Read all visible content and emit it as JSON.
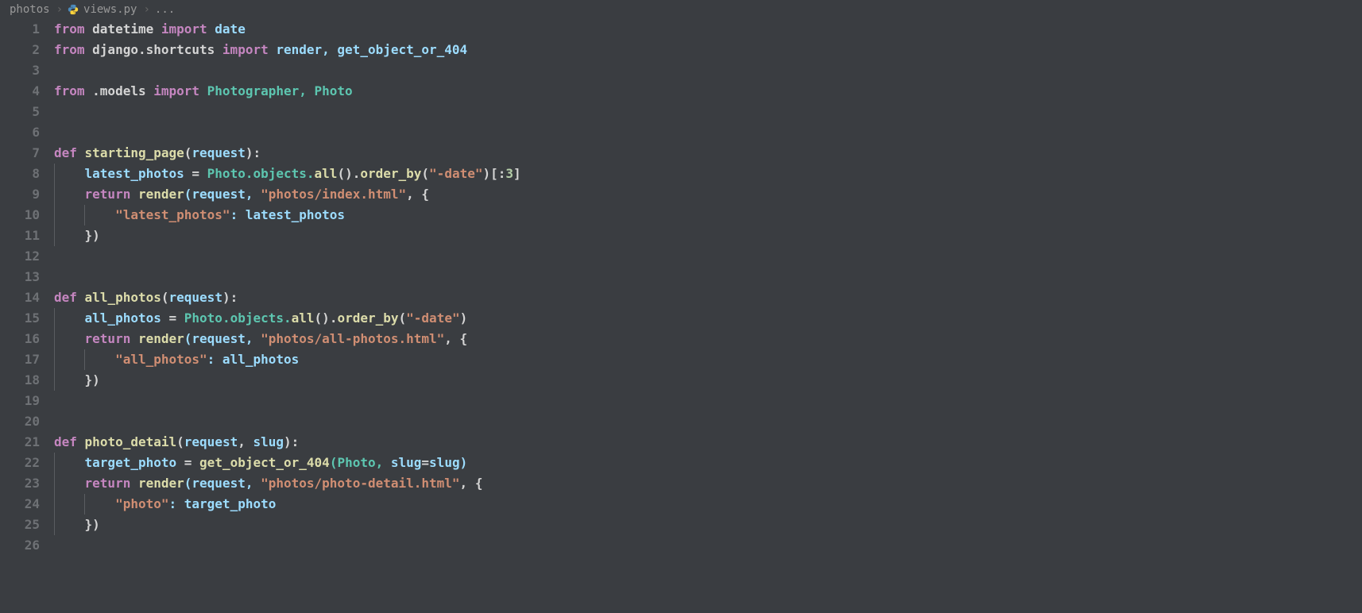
{
  "breadcrumb": {
    "folder": "photos",
    "file": "views.py",
    "symbol": "..."
  },
  "lines": [
    "1",
    "2",
    "3",
    "4",
    "5",
    "6",
    "7",
    "8",
    "9",
    "10",
    "11",
    "12",
    "13",
    "14",
    "15",
    "16",
    "17",
    "18",
    "19",
    "20",
    "21",
    "22",
    "23",
    "24",
    "25",
    "26"
  ],
  "code": {
    "l1": {
      "t1": "from",
      "t2": " datetime ",
      "t3": "import",
      "t4": " date"
    },
    "l2": {
      "t1": "from",
      "t2": " django.shortcuts ",
      "t3": "import",
      "t4": " render, get_object_or_404"
    },
    "l4": {
      "t1": "from",
      "t2": " .models ",
      "t3": "import",
      "t4": " Photographer, Photo"
    },
    "l7": {
      "t1": "def",
      "t2": " ",
      "t3": "starting_page",
      "t4": "(",
      "t5": "request",
      "t6": "):"
    },
    "l8": {
      "t1": "    latest_photos ",
      "t2": "=",
      "t3": " Photo.objects.",
      "t4": "all",
      "t5": "().",
      "t6": "order_by",
      "t7": "(",
      "t8": "\"-date\"",
      "t9": ")[:",
      "t10": "3",
      "t11": "]"
    },
    "l9": {
      "t1": "    ",
      "t2": "return",
      "t3": " ",
      "t4": "render",
      "t5": "(request, ",
      "t6": "\"photos/index.html\"",
      "t7": ", {"
    },
    "l10": {
      "t1": "        ",
      "t2": "\"latest_photos\"",
      "t3": ": latest_photos"
    },
    "l11": {
      "t1": "    })"
    },
    "l14": {
      "t1": "def",
      "t2": " ",
      "t3": "all_photos",
      "t4": "(",
      "t5": "request",
      "t6": "):"
    },
    "l15": {
      "t1": "    all_photos ",
      "t2": "=",
      "t3": " Photo.objects.",
      "t4": "all",
      "t5": "().",
      "t6": "order_by",
      "t7": "(",
      "t8": "\"-date\"",
      "t9": ")"
    },
    "l16": {
      "t1": "    ",
      "t2": "return",
      "t3": " ",
      "t4": "render",
      "t5": "(request, ",
      "t6": "\"photos/all-photos.html\"",
      "t7": ", {"
    },
    "l17": {
      "t1": "        ",
      "t2": "\"all_photos\"",
      "t3": ": all_photos"
    },
    "l18": {
      "t1": "    })"
    },
    "l21": {
      "t1": "def",
      "t2": " ",
      "t3": "photo_detail",
      "t4": "(",
      "t5": "request",
      "t6": ", ",
      "t7": "slug",
      "t8": "):"
    },
    "l22": {
      "t1": "    target_photo ",
      "t2": "=",
      "t3": " ",
      "t4": "get_object_or_404",
      "t5": "(Photo, ",
      "t6": "slug",
      "t7": "=",
      "t8": "slug)"
    },
    "l23": {
      "t1": "    ",
      "t2": "return",
      "t3": " ",
      "t4": "render",
      "t5": "(request, ",
      "t6": "\"photos/photo-detail.html\"",
      "t7": ", {"
    },
    "l24": {
      "t1": "        ",
      "t2": "\"photo\"",
      "t3": ": target_photo"
    },
    "l25": {
      "t1": "    })"
    }
  }
}
